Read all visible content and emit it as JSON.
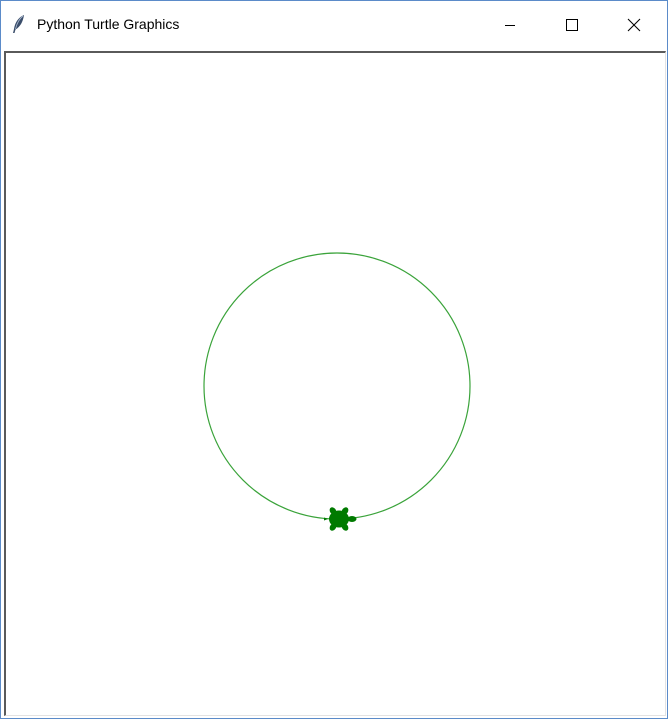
{
  "window": {
    "title": "Python Turtle Graphics",
    "controls": [
      "minimize",
      "maximize",
      "close"
    ],
    "app_icon": "feather-icon"
  },
  "canvas": {
    "background_color": "#ffffff",
    "circle": {
      "stroke_color": "#3aa33a"
    },
    "turtle": {
      "icon": "turtle-icon",
      "color": "#007a00",
      "heading": "east"
    }
  }
}
